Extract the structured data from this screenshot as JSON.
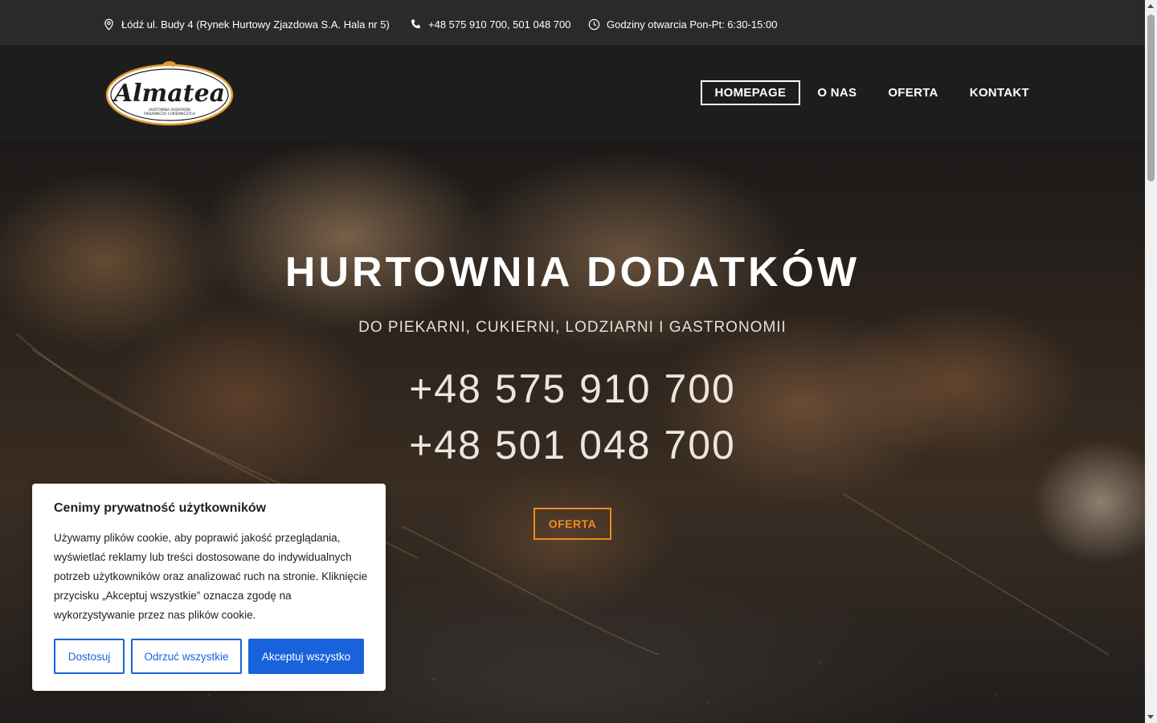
{
  "topbar": {
    "address": "Łódź ul. Budy 4 (Rynek Hurtowy Zjazdowa S.A. Hala nr 5)",
    "phone": "+48 575 910 700, 501 048 700",
    "hours": "Godziny otwarcia Pon-Pt: 6:30-15:00"
  },
  "logo": {
    "name": "Almatea",
    "tagline_1": "HURTOWNIA DODATKÓW",
    "tagline_2": "PIEKARNICZO CUKIERNICZYCH"
  },
  "nav": {
    "items": [
      {
        "label": "HOMEPAGE"
      },
      {
        "label": "O NAS"
      },
      {
        "label": "OFERTA"
      },
      {
        "label": "KONTAKT"
      }
    ]
  },
  "hero": {
    "title": "HURTOWNIA DODATKÓW",
    "subtitle": "DO PIEKARNI, CUKIERNI, LODZIARNI I GASTRONOMII",
    "phone_1": "+48 575 910 700",
    "phone_2": "+48 501 048 700",
    "button": "OFERTA"
  },
  "cookie": {
    "title": "Cenimy prywatność użytkowników",
    "text": "Używamy plików cookie, aby poprawić jakość przeglądania, wyświetlać reklamy lub treści dostosowane do indywidualnych potrzeb użytkowników oraz analizować ruch na stronie. Kliknięcie przycisku „Akceptuj wszystkie” oznacza zgodę na wykorzystywanie przez nas plików cookie.",
    "btn_customize": "Dostosuj",
    "btn_reject": "Odrzuć wszystkie",
    "btn_accept": "Akceptuj wszystko"
  },
  "colors": {
    "accent": "#f08a1d",
    "cookie_primary": "#1863dc",
    "topbar_bg": "#2a2a2a",
    "header_bg": "#1d1d1d"
  }
}
